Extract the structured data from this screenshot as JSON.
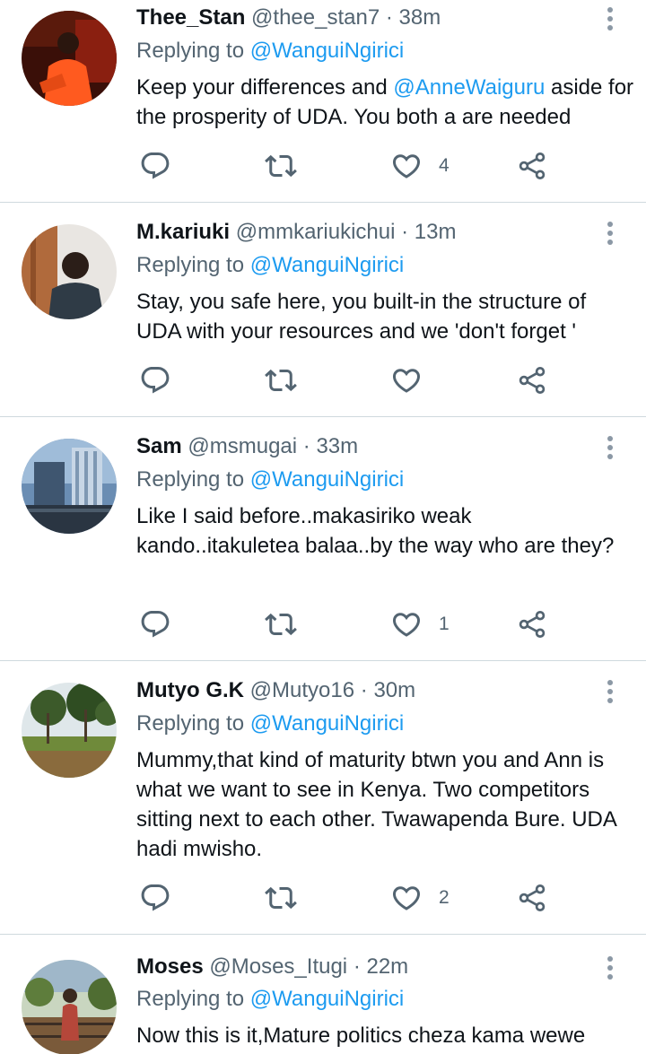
{
  "tweets": [
    {
      "display_name": "Thee_Stan",
      "handle": "@thee_stan7",
      "time": "38m",
      "replying_label": "Replying to",
      "replying_to": "@WanguiNgirici",
      "text_parts": [
        "Keep your differences and ",
        "@AnneWaiguru",
        " aside for the prosperity of UDA. You both a are needed"
      ],
      "like_count": "4",
      "icons": [
        "reply-icon",
        "retweet-icon",
        "like-icon",
        "share-icon",
        "more-icon"
      ]
    },
    {
      "display_name": "M.kariuki",
      "handle": "@mmkariukichui",
      "time": "13m",
      "replying_label": "Replying to",
      "replying_to": "@WanguiNgirici",
      "text": "Stay,  you safe here,  you built-in the structure of UDA with your resources and we 'don't forget '",
      "like_count": ""
    },
    {
      "display_name": "Sam",
      "handle": "@msmugai",
      "time": "33m",
      "replying_label": "Replying to",
      "replying_to": "@WanguiNgirici",
      "text": "Like I said before..makasiriko weak kando..itakuletea balaa..by the way who are they?",
      "like_count": "1"
    },
    {
      "display_name": "Mutyo G.K",
      "handle": "@Mutyo16",
      "time": "30m",
      "replying_label": "Replying to",
      "replying_to": "@WanguiNgirici",
      "text": "Mummy,that kind of maturity btwn you and Ann is what we want to see in Kenya. Two competitors sitting next to each other. Twawapenda Bure. UDA hadi mwisho.",
      "like_count": "2"
    },
    {
      "display_name": "Moses",
      "handle": "@Moses_Itugi",
      "time": "22m",
      "replying_label": "Replying to",
      "replying_to": "@WanguiNgirici",
      "text": "Now this is it,Mature politics cheza kama wewe"
    }
  ],
  "separator": "·",
  "colors": {
    "link": "#1d9bf0",
    "muted": "#536471",
    "text": "#0f1419",
    "divider": "#cfd9de"
  }
}
